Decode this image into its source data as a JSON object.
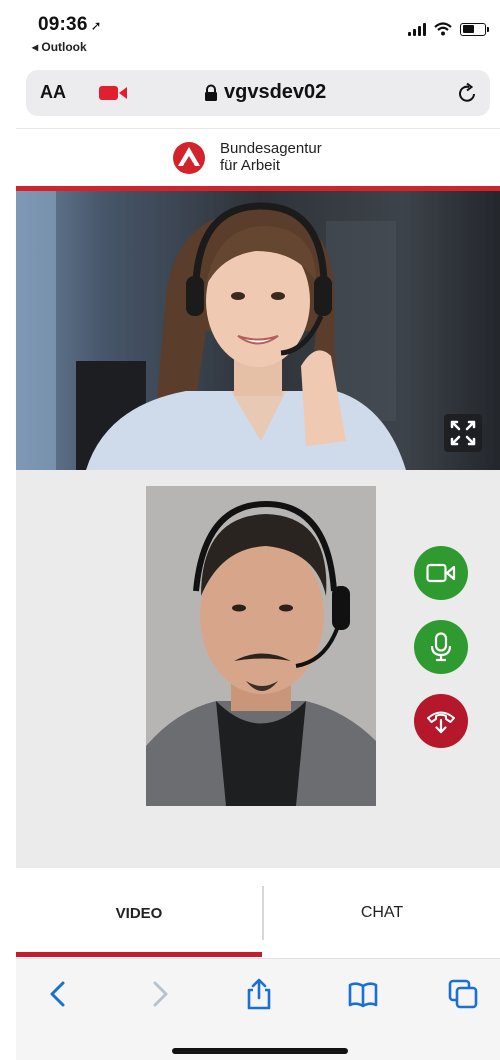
{
  "status": {
    "time": "09:36",
    "back_app": "◂ Outlook"
  },
  "address_bar": {
    "text_size_label": "AA",
    "url": "vgvsdev02"
  },
  "site": {
    "brand_line1": "Bundesagentur",
    "brand_line2": "für Arbeit",
    "brand_color": "#d2232a"
  },
  "call": {
    "controls": [
      "camera",
      "microphone",
      "hang-up"
    ],
    "control_colors": {
      "camera": "#2f9a2f",
      "microphone": "#2f9a2f",
      "hang_up": "#b4182a"
    }
  },
  "tabs": {
    "video_label": "VIDEO",
    "chat_label": "CHAT",
    "active": "VIDEO"
  },
  "toolbar": {
    "icons": [
      "back-icon",
      "forward-icon",
      "share-icon",
      "bookmarks-icon",
      "tabs-icon"
    ]
  },
  "colors": {
    "accent": "#c41e2e",
    "ios_blue": "#1a6fd6"
  }
}
